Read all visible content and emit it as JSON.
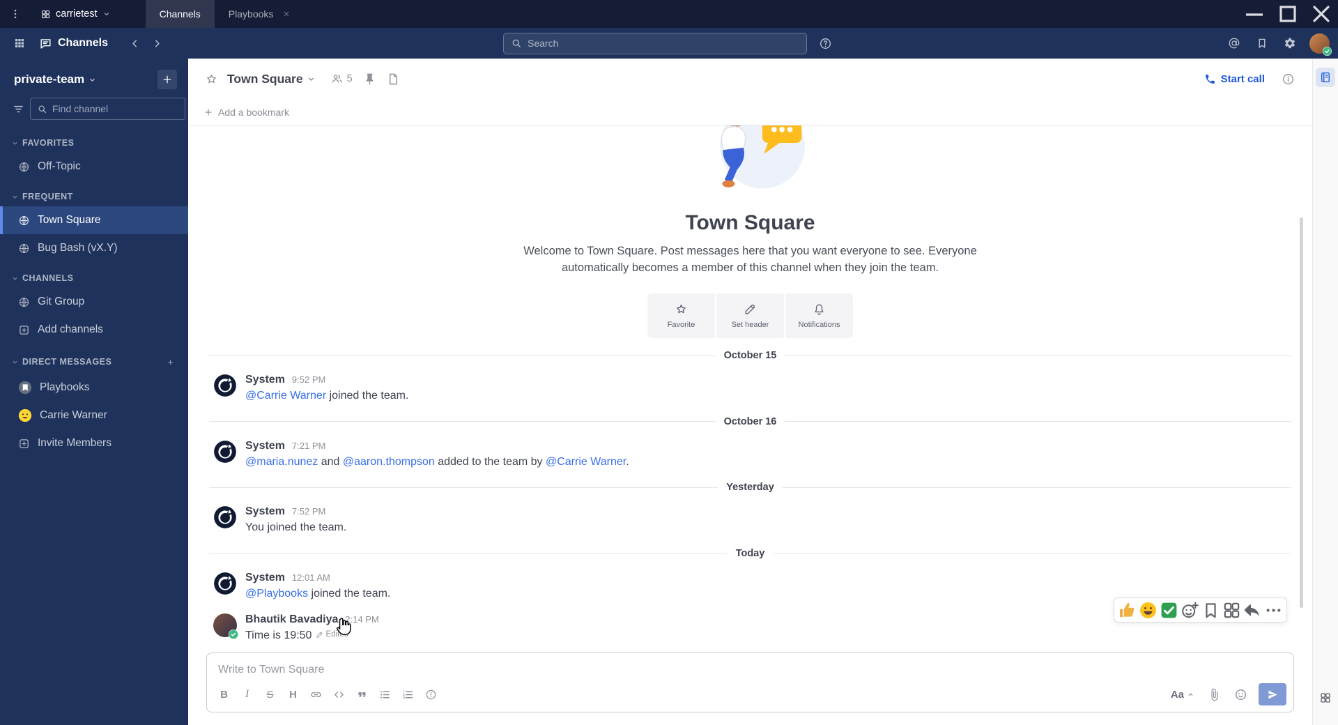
{
  "colors": {
    "titlebar_bg": "#141c36",
    "header_bg": "#1e325c",
    "sidebar_bg": "#1e325c",
    "accent_blue": "#1c58d9",
    "link_blue": "#386fe5",
    "active_item_border": "#5d89ea",
    "text_dark": "#3f4350",
    "text_muted": "#8f9197",
    "online_green": "#3db887"
  },
  "titlebar": {
    "server_name": "carrietest",
    "tabs": [
      {
        "label": "Channels",
        "active": true,
        "closable": false
      },
      {
        "label": "Playbooks",
        "active": false,
        "closable": true
      }
    ],
    "window_controls": [
      "minimize",
      "maximize",
      "close"
    ]
  },
  "global_header": {
    "product_name": "Channels",
    "search_placeholder": "Search"
  },
  "sidebar": {
    "team_name": "private-team",
    "find_placeholder": "Find channel",
    "sections": [
      {
        "title": "FAVORITES",
        "add_button": false,
        "items": [
          {
            "label": "Off-Topic",
            "icon": "globe"
          }
        ]
      },
      {
        "title": "FREQUENT",
        "add_button": false,
        "items": [
          {
            "label": "Town Square",
            "icon": "globe",
            "active": true
          },
          {
            "label": "Bug Bash (vX.Y)",
            "icon": "globe"
          }
        ]
      },
      {
        "title": "CHANNELS",
        "add_button": false,
        "items": [
          {
            "label": "Git Group",
            "icon": "globe"
          },
          {
            "label": "Add channels",
            "icon": "plus-box"
          }
        ]
      },
      {
        "title": "DIRECT MESSAGES",
        "add_button": true,
        "items": [
          {
            "label": "Playbooks",
            "icon": "playbooks-avatar"
          },
          {
            "label": "Carrie Warner",
            "icon": "emoji-avatar"
          },
          {
            "label": "Invite Members",
            "icon": "plus-box"
          }
        ]
      }
    ]
  },
  "channel_header": {
    "name": "Town Square",
    "member_count": "5",
    "start_call_label": "Start call",
    "bookmark_label": "Add a bookmark"
  },
  "intro": {
    "title": "Town Square",
    "description": "Welcome to Town Square. Post messages here that you want everyone to see. Everyone automatically becomes a member of this channel when they join the team.",
    "actions": [
      {
        "label": "Favorite",
        "icon": "star"
      },
      {
        "label": "Set header",
        "icon": "pencil"
      },
      {
        "label": "Notifications",
        "icon": "bell"
      }
    ]
  },
  "timeline": [
    {
      "type": "divider",
      "label": "October 15"
    },
    {
      "type": "post",
      "author": "System",
      "time": "9:52 PM",
      "avatar": "system",
      "parts": [
        {
          "type": "mention",
          "text": "@Carrie Warner"
        },
        {
          "type": "text",
          "text": " joined the team."
        }
      ]
    },
    {
      "type": "divider",
      "label": "October 16"
    },
    {
      "type": "post",
      "author": "System",
      "time": "7:21 PM",
      "avatar": "system",
      "parts": [
        {
          "type": "mention",
          "text": "@maria.nunez"
        },
        {
          "type": "text",
          "text": " and "
        },
        {
          "type": "mention",
          "text": "@aaron.thompson"
        },
        {
          "type": "text",
          "text": " added to the team by "
        },
        {
          "type": "mention",
          "text": "@Carrie Warner"
        },
        {
          "type": "text",
          "text": "."
        }
      ]
    },
    {
      "type": "divider",
      "label": "Yesterday"
    },
    {
      "type": "post",
      "author": "System",
      "time": "7:52 PM",
      "avatar": "system",
      "parts": [
        {
          "type": "text",
          "text": "You joined the team."
        }
      ]
    },
    {
      "type": "divider",
      "label": "Today"
    },
    {
      "type": "post",
      "author": "System",
      "time": "12:01 AM",
      "avatar": "system",
      "parts": [
        {
          "type": "mention",
          "text": "@Playbooks"
        },
        {
          "type": "text",
          "text": " joined the team."
        }
      ]
    },
    {
      "type": "post",
      "author": "Bhautik Bavadiya",
      "time": "2:14 PM",
      "avatar": "user",
      "status": "online",
      "hovered": true,
      "edited_label": "Edited",
      "parts": [
        {
          "type": "text",
          "text": "Time is 19:50"
        }
      ]
    }
  ],
  "message_hover_toolbar": {
    "reactions": [
      {
        "name": "thumbs-up-reaction",
        "icon": "thumbs-up"
      },
      {
        "name": "grinning-reaction",
        "icon": "grinning"
      },
      {
        "name": "check-mark-reaction",
        "icon": "check-mark"
      }
    ],
    "actions": [
      {
        "name": "add-reaction",
        "icon": "smiley-plus"
      },
      {
        "name": "save-message",
        "icon": "flag"
      },
      {
        "name": "message-apps",
        "icon": "apps-grid"
      },
      {
        "name": "reply",
        "icon": "reply"
      },
      {
        "name": "more-actions",
        "icon": "dots-horizontal"
      }
    ]
  },
  "composer": {
    "placeholder": "Write to Town Square",
    "formatting_toggle_label": "Aa",
    "format_buttons": [
      {
        "name": "bold",
        "glyph": "B"
      },
      {
        "name": "italic",
        "glyph": "I"
      },
      {
        "name": "strikethrough",
        "glyph": "S"
      },
      {
        "name": "heading",
        "glyph": "H"
      },
      {
        "name": "insert-link",
        "icon": "link"
      },
      {
        "name": "code",
        "icon": "code"
      },
      {
        "name": "quote",
        "icon": "quote"
      },
      {
        "name": "bulleted-list",
        "icon": "list-ul"
      },
      {
        "name": "numbered-list",
        "icon": "list-ol"
      },
      {
        "name": "message-priority",
        "icon": "priority"
      }
    ]
  },
  "apps_bar": {
    "top_icon": "journal",
    "bottom_icon": "apps-grid"
  }
}
